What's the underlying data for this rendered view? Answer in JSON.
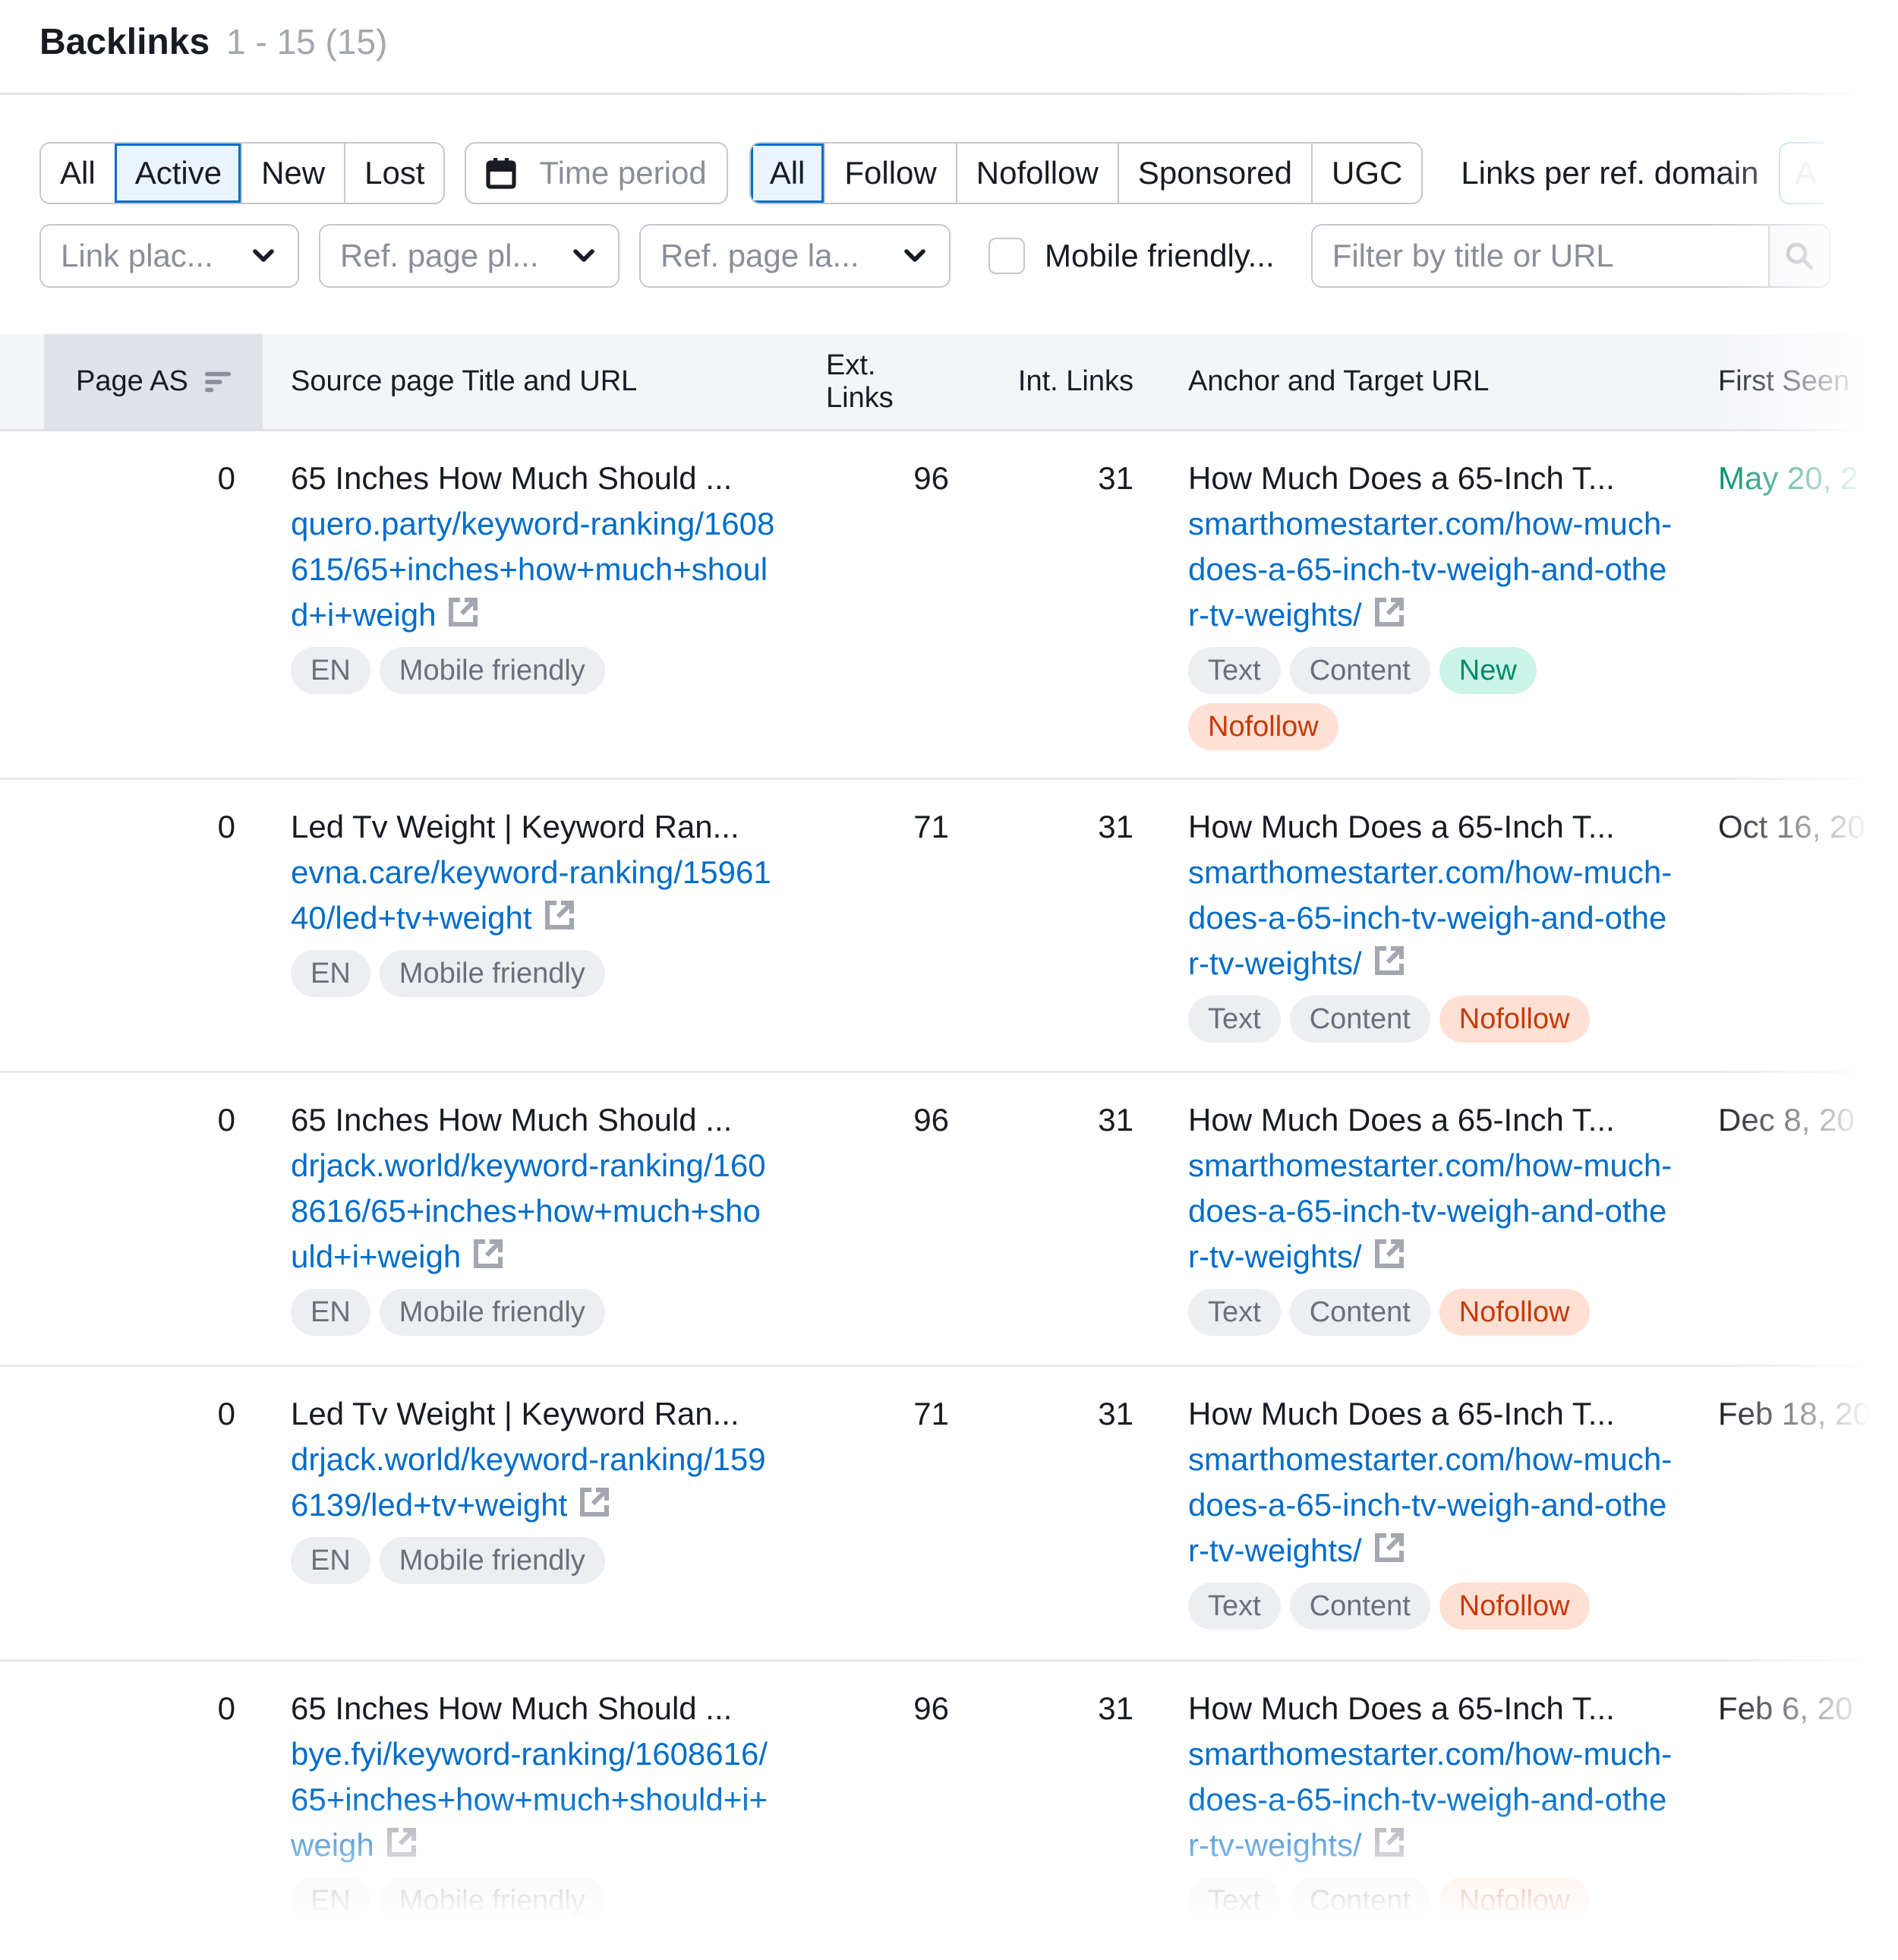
{
  "header": {
    "title": "Backlinks",
    "count": "1 - 15 (15)"
  },
  "filters": {
    "status_tabs": [
      {
        "label": "All",
        "active": false
      },
      {
        "label": "Active",
        "active": true
      },
      {
        "label": "New",
        "active": false
      },
      {
        "label": "Lost",
        "active": false
      }
    ],
    "time_period": {
      "label": "Time period",
      "icon": "calendar-icon"
    },
    "type_tabs": [
      {
        "label": "All",
        "active": true
      },
      {
        "label": "Follow",
        "active": false
      },
      {
        "label": "Nofollow",
        "active": false
      },
      {
        "label": "Sponsored",
        "active": false
      },
      {
        "label": "UGC",
        "active": false
      }
    ],
    "links_per_ref_domain": {
      "label": "Links per ref. domain",
      "value": "A"
    },
    "selects": [
      {
        "label": "Link plac...",
        "icon": "chevron-down-icon"
      },
      {
        "label": "Ref. page pl...",
        "icon": "chevron-down-icon"
      },
      {
        "label": "Ref. page la...",
        "icon": "chevron-down-icon"
      }
    ],
    "mobile_friendly": {
      "label": "Mobile friendly...",
      "checked": false
    },
    "search": {
      "placeholder": "Filter by title or URL",
      "value": "",
      "icon": "search-icon"
    }
  },
  "table": {
    "columns": {
      "page_as": "Page AS",
      "source": "Source page Title and URL",
      "ext_links": "Ext. Links",
      "int_links": "Int. Links",
      "anchor": "Anchor and Target URL",
      "first_seen": "First Seen"
    },
    "sorted_by": "page_as",
    "rows": [
      {
        "page_as": "0",
        "source_title": "65 Inches How Much Should ...",
        "source_url": "quero.party/keyword-ranking/1608615/65+inches+how+much+should+i+weigh",
        "source_tags": [
          "EN",
          "Mobile friendly"
        ],
        "ext_links": "96",
        "int_links": "31",
        "anchor_title": "How Much Does a 65-Inch T...",
        "target_url": "smarthomestarter.com/how-much-does-a-65-inch-tv-weigh-and-other-tv-weights/",
        "anchor_tags": [
          {
            "label": "Text",
            "style": "gray"
          },
          {
            "label": "Content",
            "style": "gray"
          },
          {
            "label": "New",
            "style": "green"
          },
          {
            "label": "Nofollow",
            "style": "orange"
          }
        ],
        "first_seen": "May 20, 2",
        "first_seen_new": true
      },
      {
        "page_as": "0",
        "source_title": "Led Tv Weight | Keyword Ran...",
        "source_url": "evna.care/keyword-ranking/1596140/led+tv+weight",
        "source_tags": [
          "EN",
          "Mobile friendly"
        ],
        "ext_links": "71",
        "int_links": "31",
        "anchor_title": "How Much Does a 65-Inch T...",
        "target_url": "smarthomestarter.com/how-much-does-a-65-inch-tv-weigh-and-other-tv-weights/",
        "anchor_tags": [
          {
            "label": "Text",
            "style": "gray"
          },
          {
            "label": "Content",
            "style": "gray"
          },
          {
            "label": "Nofollow",
            "style": "orange"
          }
        ],
        "first_seen": "Oct 16, 20",
        "first_seen_new": false
      },
      {
        "page_as": "0",
        "source_title": "65 Inches How Much Should ...",
        "source_url": "drjack.world/keyword-ranking/1608616/65+inches+how+much+should+i+weigh",
        "source_tags": [
          "EN",
          "Mobile friendly"
        ],
        "ext_links": "96",
        "int_links": "31",
        "anchor_title": "How Much Does a 65-Inch T...",
        "target_url": "smarthomestarter.com/how-much-does-a-65-inch-tv-weigh-and-other-tv-weights/",
        "anchor_tags": [
          {
            "label": "Text",
            "style": "gray"
          },
          {
            "label": "Content",
            "style": "gray"
          },
          {
            "label": "Nofollow",
            "style": "orange"
          }
        ],
        "first_seen": "Dec 8, 20",
        "first_seen_new": false
      },
      {
        "page_as": "0",
        "source_title": "Led Tv Weight | Keyword Ran...",
        "source_url": "drjack.world/keyword-ranking/1596139/led+tv+weight",
        "source_tags": [
          "EN",
          "Mobile friendly"
        ],
        "ext_links": "71",
        "int_links": "31",
        "anchor_title": "How Much Does a 65-Inch T...",
        "target_url": "smarthomestarter.com/how-much-does-a-65-inch-tv-weigh-and-other-tv-weights/",
        "anchor_tags": [
          {
            "label": "Text",
            "style": "gray"
          },
          {
            "label": "Content",
            "style": "gray"
          },
          {
            "label": "Nofollow",
            "style": "orange"
          }
        ],
        "first_seen": "Feb 18, 20",
        "first_seen_new": false
      },
      {
        "page_as": "0",
        "source_title": "65 Inches How Much Should ...",
        "source_url": "bye.fyi/keyword-ranking/1608616/65+inches+how+much+should+i+weigh",
        "source_tags": [
          "EN",
          "Mobile friendly"
        ],
        "ext_links": "96",
        "int_links": "31",
        "anchor_title": "How Much Does a 65-Inch T...",
        "target_url": "smarthomestarter.com/how-much-does-a-65-inch-tv-weigh-and-other-tv-weights/",
        "anchor_tags": [
          {
            "label": "Text",
            "style": "gray"
          },
          {
            "label": "Content",
            "style": "gray"
          },
          {
            "label": "Nofollow",
            "style": "orange"
          }
        ],
        "first_seen": "Feb 6, 20",
        "first_seen_new": false
      }
    ]
  },
  "colors": {
    "link": "#006dca",
    "active_bg": "#e9f4ff",
    "active_border": "#006dca",
    "new_green": "#008a6b",
    "nofollow_orange": "#c43a08"
  }
}
